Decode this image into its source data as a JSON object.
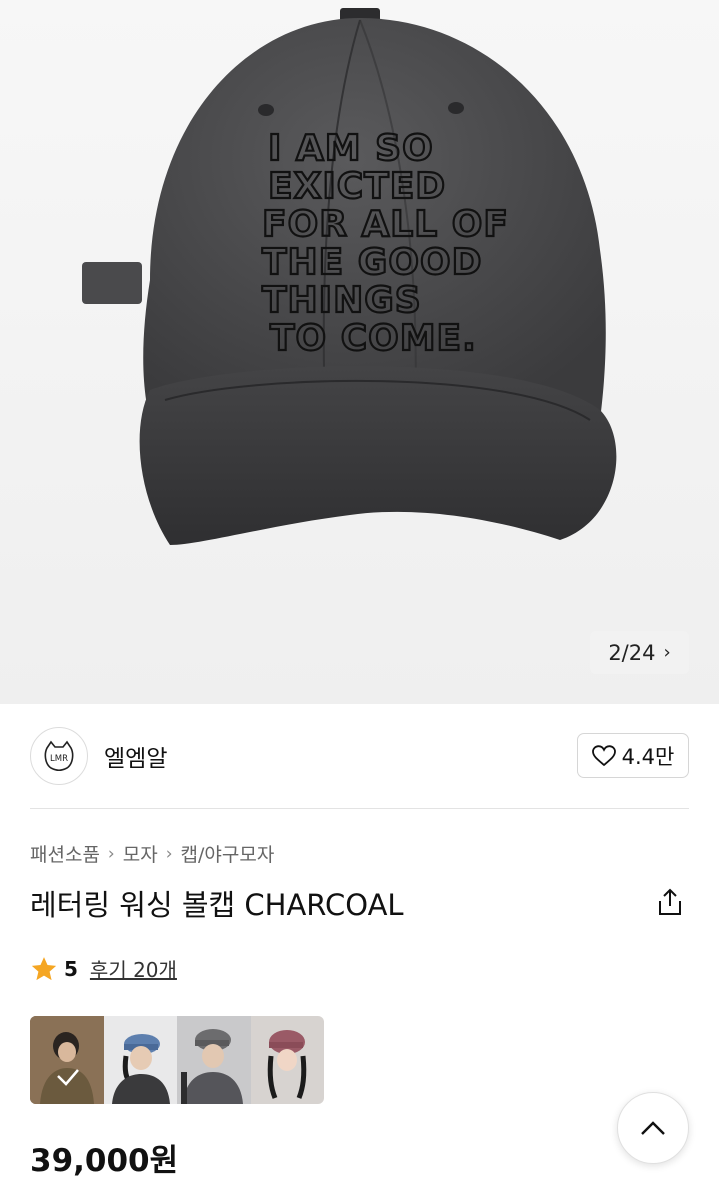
{
  "gallery": {
    "image_alt": "charcoal washed lettering ball cap",
    "counter": "2/24",
    "cap_embroidery": [
      "I AM SO",
      "EXICTED",
      "FOR ALL OF",
      "THE GOOD",
      "THINGS",
      "TO COME."
    ]
  },
  "store": {
    "logo_text": "LMR",
    "name": "엘엠알",
    "likes": "4.4만"
  },
  "breadcrumb": [
    "패션소품",
    "모자",
    "캡/야구모자"
  ],
  "product": {
    "title": "레터링 워싱 볼캡 CHARCOAL",
    "rating": "5",
    "review_link": "후기 20개",
    "price": "39,000원"
  },
  "colors": {
    "star": "#f5a623",
    "cap": "#4a4a4c"
  }
}
